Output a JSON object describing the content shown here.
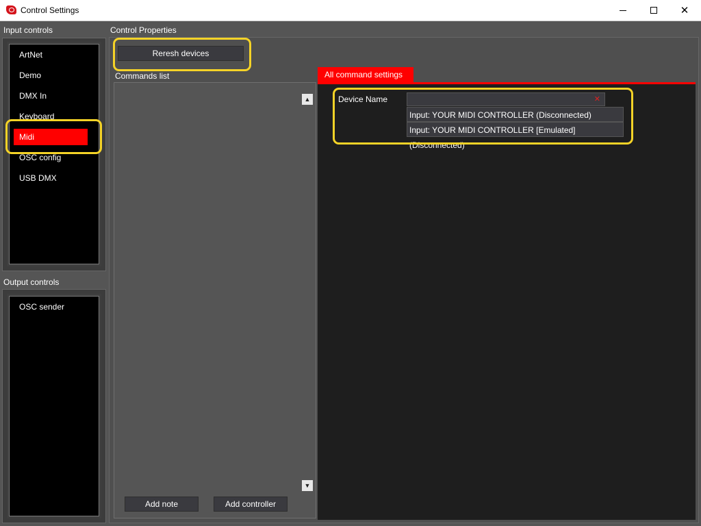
{
  "window": {
    "title": "Control Settings"
  },
  "input_controls": {
    "label": "Input controls",
    "items": [
      {
        "label": "ArtNet"
      },
      {
        "label": "Demo"
      },
      {
        "label": "DMX In"
      },
      {
        "label": "Keyboard"
      },
      {
        "label": "Midi",
        "selected": true
      },
      {
        "label": "OSC config"
      },
      {
        "label": "USB DMX"
      }
    ]
  },
  "output_controls": {
    "label": "Output controls",
    "items": [
      {
        "label": "OSC sender"
      }
    ]
  },
  "control_properties": {
    "label": "Control Properties",
    "refresh_button": "Reresh devices",
    "commands_list_label": "Commands list",
    "add_note_button": "Add note",
    "add_controller_button": "Add controller"
  },
  "command_settings": {
    "tab_label": "All command settings",
    "device_name_label": "Device Name",
    "dropdown_options": [
      "Input: YOUR MIDI CONTROLLER (Disconnected)",
      "Input: YOUR MIDI CONTROLLER [Emulated] (Disconnected)"
    ]
  },
  "colors": {
    "accent": "#ff0000",
    "highlight": "#f5d327"
  }
}
